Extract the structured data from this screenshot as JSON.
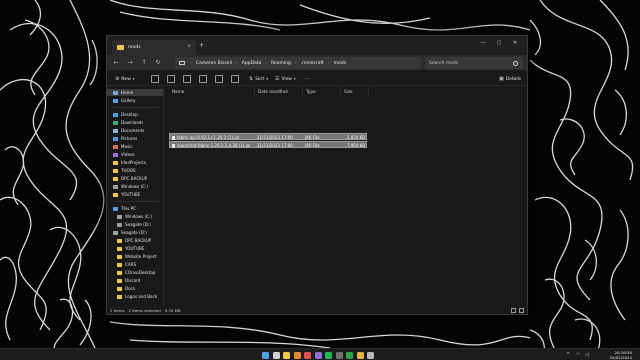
{
  "window": {
    "tab_title": "mods",
    "tab_close": "×",
    "new_tab": "+",
    "controls": {
      "minimize": "—",
      "maximize": "▢",
      "close": "✕"
    }
  },
  "nav": {
    "back": "←",
    "forward": "→",
    "up": "↑",
    "refresh": "↻"
  },
  "address": {
    "crumbs": [
      "Cameron Bissell",
      "AppData",
      "Roaming",
      ".minecraft",
      "mods"
    ],
    "separator": "›"
  },
  "search": {
    "placeholder": "Search mods"
  },
  "commands": {
    "new_label": "New",
    "sort_label": "Sort",
    "view_label": "View",
    "more_label": "···",
    "details_label": "Details"
  },
  "sidebar": {
    "quick": [
      {
        "label": "Home",
        "icon": "home-icon",
        "color": "#6fa8dc"
      },
      {
        "label": "Gallery",
        "icon": "gallery-icon",
        "color": "#5aa0e8"
      }
    ],
    "pinned": [
      {
        "label": "Desktop",
        "icon": "desktop-icon",
        "color": "#4aa3df"
      },
      {
        "label": "Downloads",
        "icon": "downloads-icon",
        "color": "#3bb273"
      },
      {
        "label": "Documents",
        "icon": "documents-icon",
        "color": "#8fb8de"
      },
      {
        "label": "Pictures",
        "icon": "pictures-icon",
        "color": "#4f9be0"
      },
      {
        "label": "Music",
        "icon": "music-icon",
        "color": "#e06b5b"
      },
      {
        "label": "Videos",
        "icon": "videos-icon",
        "color": "#9b6fd6"
      },
      {
        "label": "IdeaProjects",
        "icon": "folder-icon",
        "color": "#f2c94c"
      },
      {
        "label": "THOOS",
        "icon": "folder-icon",
        "color": "#f2c94c"
      },
      {
        "label": "DPC BACKUP",
        "icon": "folder-icon",
        "color": "#f2c94c"
      },
      {
        "label": "Windows (C:)",
        "icon": "drive-icon",
        "color": "#9aa0a6"
      },
      {
        "label": "YOUTUBE",
        "icon": "folder-icon",
        "color": "#f2c94c"
      }
    ],
    "tree": [
      {
        "label": "This PC",
        "icon": "pc-icon",
        "color": "#5aa0e8",
        "indent": 0
      },
      {
        "label": "Windows (C:)",
        "icon": "drive-icon",
        "color": "#9aa0a6",
        "indent": 1
      },
      {
        "label": "Seagate (D:)",
        "icon": "drive-icon",
        "color": "#9aa0a6",
        "indent": 1
      },
      {
        "label": "Seagate (D:)",
        "icon": "drive-icon",
        "color": "#9aa0a6",
        "indent": 0
      },
      {
        "label": "DPC BACKUP",
        "icon": "folder-icon",
        "color": "#f2c94c",
        "indent": 1
      },
      {
        "label": "YOUTUBE",
        "icon": "folder-icon",
        "color": "#f2c94c",
        "indent": 1
      },
      {
        "label": "Website Project",
        "icon": "folder-icon",
        "color": "#f2c94c",
        "indent": 1
      },
      {
        "label": "CARS",
        "icon": "folder-icon",
        "color": "#f2c94c",
        "indent": 1
      },
      {
        "label": "COnvoDesktop",
        "icon": "folder-icon",
        "color": "#f2c94c",
        "indent": 1
      },
      {
        "label": "Discord",
        "icon": "folder-icon",
        "color": "#f2c94c",
        "indent": 1
      },
      {
        "label": "Docs",
        "icon": "folder-icon",
        "color": "#f2c94c",
        "indent": 1
      },
      {
        "label": "Logos and Back",
        "icon": "folder-icon",
        "color": "#f2c94c",
        "indent": 1
      }
    ]
  },
  "columns": [
    "Name",
    "Date modified",
    "Type",
    "Size"
  ],
  "files": [
    {
      "name": "fabric-api-0.92.1+1.20.2 (1).jar",
      "date": "21/11/2023 17:00",
      "type": "JAR File",
      "size": "2,020 KB"
    },
    {
      "name": "voicechat-fabric-1.20.2-2.4.28 (1).jar",
      "date": "21/11/2023 17:00",
      "type": "JAR File",
      "size": "7,964 KB"
    }
  ],
  "status": {
    "items": "2 items",
    "selection": "2 items selected",
    "size": "9.70 MB"
  },
  "clock": {
    "time": "20:28:50",
    "date": "24/02/2024"
  },
  "taskbar": {
    "icons": [
      {
        "name": "start-icon",
        "color": "#4aa3df"
      },
      {
        "name": "search-icon",
        "color": "#cfcfcf"
      },
      {
        "name": "file-explorer-icon",
        "color": "#f2c94c"
      },
      {
        "name": "browser-icon",
        "color": "#e8833a"
      },
      {
        "name": "app-icon-red",
        "color": "#d9534f"
      },
      {
        "name": "app-icon-purple",
        "color": "#8e6bd6"
      },
      {
        "name": "spotify-icon",
        "color": "#1db954"
      },
      {
        "name": "app-icon-dark",
        "color": "#6f6f6f"
      },
      {
        "name": "app-icon-green",
        "color": "#2aa748"
      },
      {
        "name": "app-icon-yellow",
        "color": "#e3b341"
      },
      {
        "name": "app-icon-gray",
        "color": "#b8b8b8"
      }
    ],
    "tray": "^"
  }
}
